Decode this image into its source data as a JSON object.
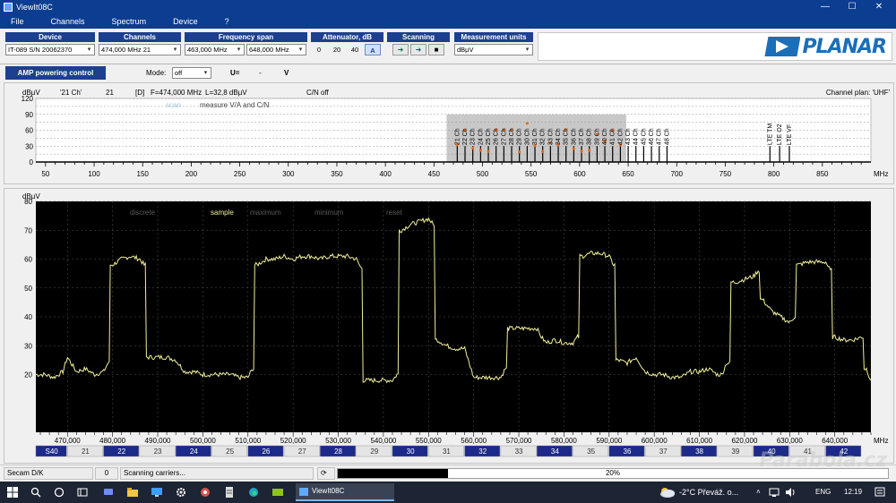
{
  "window": {
    "title": "ViewIt08C",
    "min": "—",
    "max": "☐",
    "close": "✕"
  },
  "menu": [
    "File",
    "Channels",
    "Spectrum",
    "Device",
    "?"
  ],
  "toolbar": {
    "device": {
      "header": "Device",
      "value": "IT-089 S/N 20062370"
    },
    "channels": {
      "header": "Channels",
      "value": "474,000 MHz  21"
    },
    "span": {
      "header": "Frequency span",
      "from": "463,000 MHz",
      "to": "648,000 MHz"
    },
    "attenuator": {
      "header": "Attenuator, dB",
      "options": [
        "0",
        "20",
        "40"
      ],
      "auto": "A"
    },
    "scanning": {
      "header": "Scanning",
      "buttons": [
        "➜",
        "➜",
        "■"
      ]
    },
    "units": {
      "header": "Measurement units",
      "value": "dBµV"
    }
  },
  "logo": {
    "text": "PLANAR"
  },
  "amp": {
    "button": "AMP powering control",
    "mode_label": "Mode:",
    "mode_value": "off",
    "u_label": "U=",
    "u_value": "-",
    "u_unit": "V"
  },
  "upper": {
    "ylabel": "dBµV",
    "info": {
      "channel": "'21 Ch'",
      "num": "21",
      "flag": "[D]",
      "freq": "F=474,000 MHz",
      "level": "L=32,8 dBµV",
      "cn": "C/N off",
      "plan": "Channel plan: 'UHF'"
    },
    "scan": "scan",
    "measure": "measure V/A and C/N",
    "yticks": [
      0,
      15,
      30,
      45,
      60,
      75,
      90,
      105,
      120
    ],
    "ytick_labels": [
      "0",
      "30",
      "60",
      "90",
      "120"
    ],
    "xticks": [
      50,
      100,
      150,
      200,
      250,
      300,
      350,
      400,
      450,
      500,
      550,
      600,
      650,
      700,
      750,
      800,
      850
    ],
    "xunit": "MHz",
    "xrange": [
      40,
      900
    ],
    "span": [
      463,
      648
    ],
    "channels": [
      {
        "label": "21 Ch",
        "f": 474,
        "v": 33
      },
      {
        "label": "22 Ch",
        "f": 482,
        "v": 60
      },
      {
        "label": "23 Ch",
        "f": 490,
        "v": 26
      },
      {
        "label": "24 Ch",
        "f": 498,
        "v": 22
      },
      {
        "label": "25 Ch",
        "f": 506,
        "v": 20
      },
      {
        "label": "26 Ch",
        "f": 514,
        "v": 61
      },
      {
        "label": "27 Ch",
        "f": 522,
        "v": 61
      },
      {
        "label": "28 Ch",
        "f": 530,
        "v": 61
      },
      {
        "label": "29 Ch",
        "f": 538,
        "v": 19
      },
      {
        "label": "30 Ch",
        "f": 546,
        "v": 73
      },
      {
        "label": "31 Ch",
        "f": 554,
        "v": 31
      },
      {
        "label": "32 Ch",
        "f": 562,
        "v": 20
      },
      {
        "label": "33 Ch",
        "f": 570,
        "v": 36
      },
      {
        "label": "34 Ch",
        "f": 578,
        "v": 33
      },
      {
        "label": "35 Ch",
        "f": 586,
        "v": 61
      },
      {
        "label": "36 Ch",
        "f": 594,
        "v": 25
      },
      {
        "label": "37 Ch",
        "f": 602,
        "v": 20
      },
      {
        "label": "38 Ch",
        "f": 610,
        "v": 22
      },
      {
        "label": "39 Ch",
        "f": 618,
        "v": 52
      },
      {
        "label": "40 Ch",
        "f": 626,
        "v": 40
      },
      {
        "label": "41 Ch",
        "f": 634,
        "v": 59
      },
      {
        "label": "42 Ch",
        "f": 642,
        "v": 32
      },
      {
        "label": "43 Ch",
        "f": 650,
        "v": 0
      },
      {
        "label": "44 Ch",
        "f": 658,
        "v": 0
      },
      {
        "label": "45 Ch",
        "f": 666,
        "v": 0
      },
      {
        "label": "46 Ch",
        "f": 674,
        "v": 0
      },
      {
        "label": "47 Ch",
        "f": 682,
        "v": 0
      },
      {
        "label": "48 Ch",
        "f": 690,
        "v": 0
      },
      {
        "label": "LTE TM",
        "f": 796,
        "v": 0
      },
      {
        "label": "LTE O2",
        "f": 806,
        "v": 0
      },
      {
        "label": "LTE VF",
        "f": 816,
        "v": 0
      }
    ]
  },
  "lower": {
    "ylabel": "dBµV",
    "modes": [
      "discrete",
      "sample",
      "maximum",
      "minimum",
      "reset"
    ],
    "active_mode": "sample",
    "yticks": [
      20,
      30,
      40,
      50,
      60,
      70,
      80
    ],
    "ymin": 0,
    "ymax": 80,
    "xmin": 463,
    "xmax": 648,
    "xticks": [
      470,
      480,
      490,
      500,
      510,
      520,
      530,
      540,
      550,
      560,
      570,
      580,
      590,
      600,
      610,
      620,
      630,
      640
    ],
    "xtick_labels": [
      "470,000",
      "480,000",
      "490,000",
      "500,000",
      "510,000",
      "520,000",
      "530,000",
      "540,000",
      "550,000",
      "560,000",
      "570,000",
      "580,000",
      "590,000",
      "600,000",
      "610,000",
      "620,000",
      "630,000",
      "640,000"
    ],
    "xunit": "MHz",
    "trace_color": "#f2ef9a",
    "channel_bar": [
      {
        "label": "S40",
        "dark": true
      },
      {
        "label": "21",
        "dark": false
      },
      {
        "label": "22",
        "dark": true
      },
      {
        "label": "23",
        "dark": false
      },
      {
        "label": "24",
        "dark": true
      },
      {
        "label": "25",
        "dark": false
      },
      {
        "label": "26",
        "dark": true
      },
      {
        "label": "27",
        "dark": false
      },
      {
        "label": "28",
        "dark": true
      },
      {
        "label": "29",
        "dark": false
      },
      {
        "label": "30",
        "dark": true
      },
      {
        "label": "31",
        "dark": false
      },
      {
        "label": "32",
        "dark": true
      },
      {
        "label": "33",
        "dark": false
      },
      {
        "label": "34",
        "dark": true
      },
      {
        "label": "35",
        "dark": false
      },
      {
        "label": "36",
        "dark": true
      },
      {
        "label": "37",
        "dark": false
      },
      {
        "label": "38",
        "dark": true
      },
      {
        "label": "39",
        "dark": false
      },
      {
        "label": "40",
        "dark": true
      },
      {
        "label": "41",
        "dark": false
      },
      {
        "label": "42",
        "dark": true
      }
    ]
  },
  "chart_data": {
    "type": "line",
    "xlabel": "MHz",
    "ylabel": "dBµV",
    "xlim": [
      463,
      648
    ],
    "ylim": [
      0,
      80
    ],
    "series": [
      {
        "x": [
          463,
          465,
          467,
          469,
          470,
          472,
          474,
          476,
          478,
          479,
          480,
          482,
          484,
          486,
          487,
          488,
          490,
          492,
          494,
          496,
          498,
          500,
          502,
          504,
          506,
          508,
          510,
          511,
          512,
          514,
          516,
          518,
          520,
          522,
          524,
          526,
          528,
          530,
          532,
          534,
          535,
          536,
          538,
          540,
          542,
          543,
          544,
          546,
          548,
          550,
          551,
          552,
          554,
          556,
          558,
          559,
          560,
          562,
          564,
          566,
          567,
          568,
          570,
          572,
          574,
          575,
          576,
          578,
          580,
          582,
          583,
          584,
          586,
          588,
          590,
          591,
          592,
          594,
          596,
          598,
          600,
          602,
          604,
          606,
          608,
          610,
          612,
          614,
          615,
          616,
          618,
          620,
          622,
          623,
          624,
          626,
          628,
          630,
          631,
          632,
          634,
          636,
          638,
          639,
          640,
          642,
          644,
          646,
          647,
          648
        ],
        "y": [
          20,
          20,
          19,
          21,
          26,
          21,
          22,
          20,
          21,
          24,
          58,
          60,
          61,
          60,
          58,
          26,
          26,
          26,
          25,
          21,
          21,
          20,
          20,
          20,
          20,
          19,
          19,
          22,
          58,
          60,
          60,
          61,
          60,
          61,
          61,
          60,
          61,
          61,
          61,
          60,
          57,
          18,
          18,
          18,
          18,
          20,
          70,
          72,
          73,
          74,
          72,
          32,
          30,
          29,
          29,
          24,
          19,
          19,
          19,
          19,
          22,
          36,
          36,
          36,
          36,
          33,
          31,
          32,
          31,
          31,
          33,
          61,
          62,
          62,
          61,
          58,
          25,
          24,
          26,
          21,
          20,
          20,
          19,
          19,
          21,
          21,
          22,
          20,
          20,
          24,
          52,
          53,
          54,
          56,
          46,
          42,
          40,
          38,
          40,
          58,
          59,
          59,
          59,
          56,
          33,
          32,
          32,
          33,
          22,
          18
        ]
      }
    ]
  },
  "status": {
    "system": "Secam D/K",
    "count": "0",
    "message": "Scanning carriers...",
    "progress": 20,
    "progress_text": "20%"
  },
  "taskbar": {
    "app": "ViewIt08C",
    "weather": "-2°C  Převáž. o...",
    "lang": "ENG",
    "time": "12:19"
  },
  "watermark": "Parabola.cz"
}
